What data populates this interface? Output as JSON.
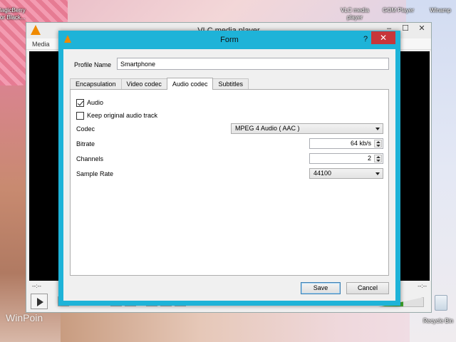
{
  "desktop": {
    "icons": [
      {
        "label_line1": "lagicBerry",
        "label_line2": "or Black..."
      },
      {
        "label_line1": "VLC media",
        "label_line2": "player"
      },
      {
        "label_line1": "GOM Player",
        "label_line2": ""
      },
      {
        "label_line1": "Winamp",
        "label_line2": ""
      },
      {
        "label_line1": "Recycle Bin",
        "label_line2": ""
      }
    ],
    "watermark": "WinPoin"
  },
  "vlc": {
    "title": "VLC media player",
    "menu_media": "Media",
    "time_elapsed": "--:--",
    "time_total": "--:--",
    "window_buttons": {
      "minimize": "–",
      "maximize": "☐",
      "close": "✕"
    },
    "volume_fraction": 0.55
  },
  "form": {
    "title": "Form",
    "help_glyph": "?",
    "close_glyph": "✕",
    "profile_label": "Profile Name",
    "profile_value": "Smartphone",
    "tabs": [
      "Encapsulation",
      "Video codec",
      "Audio codec",
      "Subtitles"
    ],
    "active_tab": "Audio codec",
    "audio_checkbox": {
      "label": "Audio",
      "checked": true
    },
    "keep_original": {
      "label": "Keep original audio track",
      "checked": false
    },
    "codec": {
      "label": "Codec",
      "value": "MPEG 4 Audio ( AAC )"
    },
    "bitrate": {
      "label": "Bitrate",
      "value": "64 kb/s"
    },
    "channels": {
      "label": "Channels",
      "value": "2"
    },
    "sample_rate": {
      "label": "Sample Rate",
      "value": "44100"
    },
    "save_label": "Save",
    "cancel_label": "Cancel"
  },
  "colors": {
    "dialog_frame": "#1eb3d8",
    "close_button": "#c7363a",
    "vlc_orange": "#f08a00"
  }
}
